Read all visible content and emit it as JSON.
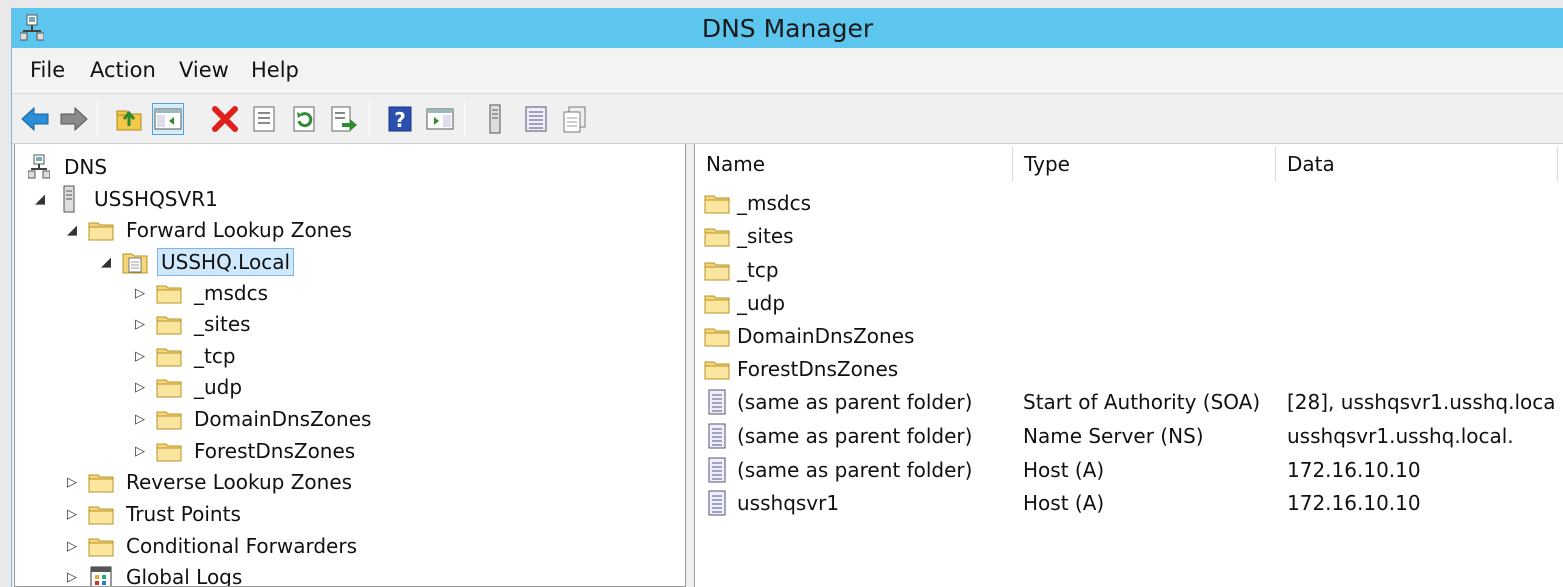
{
  "window": {
    "title": "DNS Manager"
  },
  "menu": [
    "File",
    "Action",
    "View",
    "Help"
  ],
  "toolbar": [
    "back-icon",
    "forward-icon",
    "up-folder-icon",
    "show-hide-console-tree-icon",
    "delete-icon",
    "properties-icon",
    "refresh-icon",
    "export-list-icon",
    "help-icon",
    "show-action-pane-icon",
    "server-icon",
    "record-list-icon",
    "record-copy-icon"
  ],
  "tree": {
    "root": "DNS",
    "server": "USSHQSVR1",
    "forward_zones": "Forward Lookup Zones",
    "zone": "USSHQ.Local",
    "zone_children": [
      "_msdcs",
      "_sites",
      "_tcp",
      "_udp",
      "DomainDnsZones",
      "ForestDnsZones"
    ],
    "reverse_zones": "Reverse Lookup Zones",
    "trust_points": "Trust Points",
    "conditional_forwarders": "Conditional Forwarders",
    "global_logs": "Global Logs"
  },
  "list": {
    "columns": [
      "Name",
      "Type",
      "Data"
    ],
    "rows": [
      {
        "name": "_msdcs",
        "type": "",
        "data": "",
        "icon": "folder-icon"
      },
      {
        "name": "_sites",
        "type": "",
        "data": "",
        "icon": "folder-icon"
      },
      {
        "name": "_tcp",
        "type": "",
        "data": "",
        "icon": "folder-icon"
      },
      {
        "name": "_udp",
        "type": "",
        "data": "",
        "icon": "folder-icon"
      },
      {
        "name": "DomainDnsZones",
        "type": "",
        "data": "",
        "icon": "folder-icon"
      },
      {
        "name": "ForestDnsZones",
        "type": "",
        "data": "",
        "icon": "folder-icon"
      },
      {
        "name": "(same as parent folder)",
        "type": "Start of Authority (SOA)",
        "data": "[28], usshqsvr1.usshq.loca...",
        "icon": "record-icon"
      },
      {
        "name": "(same as parent folder)",
        "type": "Name Server (NS)",
        "data": "usshqsvr1.usshq.local.",
        "icon": "record-icon"
      },
      {
        "name": "(same as parent folder)",
        "type": "Host (A)",
        "data": "172.16.10.10",
        "icon": "record-icon"
      },
      {
        "name": "usshqsvr1",
        "type": "Host (A)",
        "data": "172.16.10.10",
        "icon": "record-icon"
      }
    ]
  }
}
